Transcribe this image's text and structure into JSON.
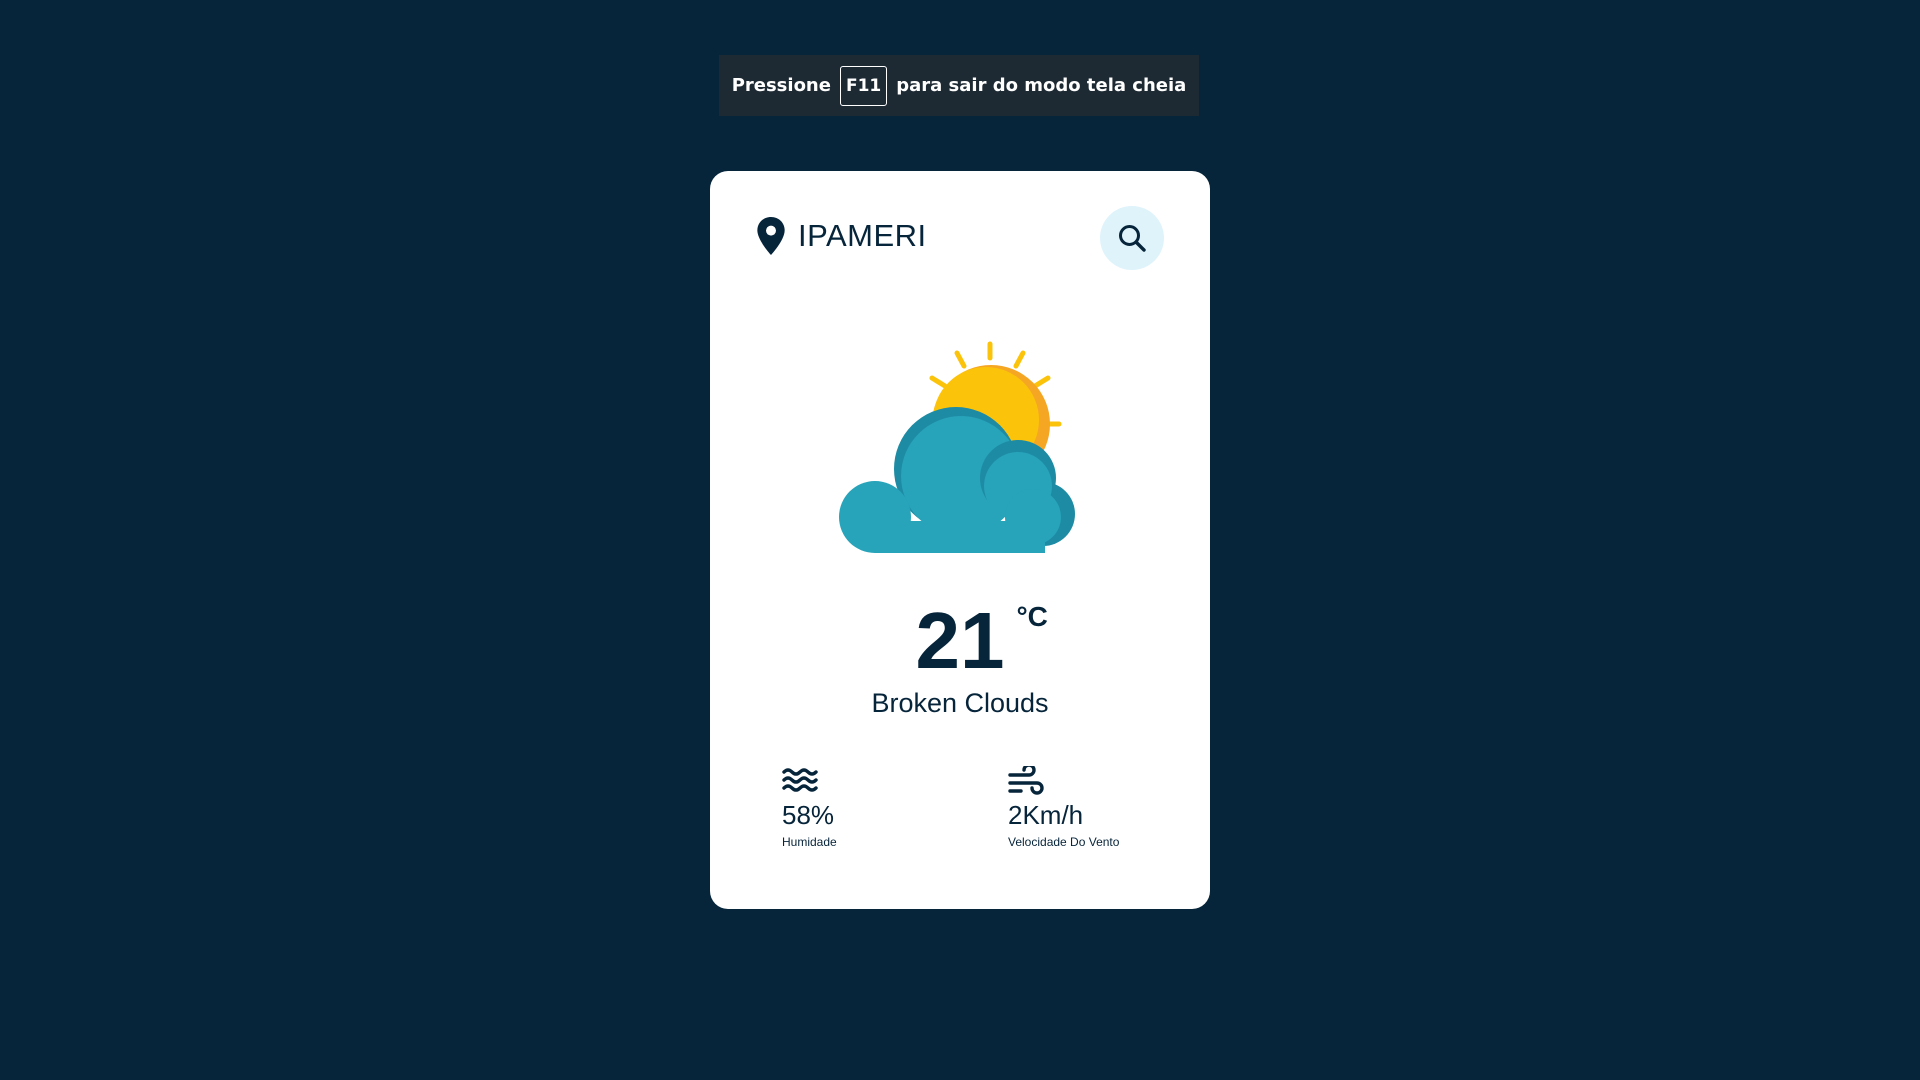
{
  "banner": {
    "prefix": "Pressione",
    "key": "F11",
    "suffix": "para sair do modo tela cheia"
  },
  "weather": {
    "city": "IPAMERI",
    "temperature": "21",
    "unit": "°C",
    "description": "Broken Clouds",
    "condition_icon": "sun-behind-cloud-icon",
    "humidity": {
      "value": "58%",
      "label": "Humidade",
      "icon": "water-waves-icon"
    },
    "wind": {
      "value": "2Km/h",
      "label": "Velocidade Do Vento",
      "icon": "wind-icon"
    }
  },
  "colors": {
    "background": "#06243a",
    "card": "#ffffff",
    "text": "#06243a",
    "search_bg": "#dff3fb",
    "sun": "#fcc30b",
    "sun_shade": "#f5a623",
    "cloud": "#27a3ba",
    "cloud_shade": "#1d8ba3"
  }
}
